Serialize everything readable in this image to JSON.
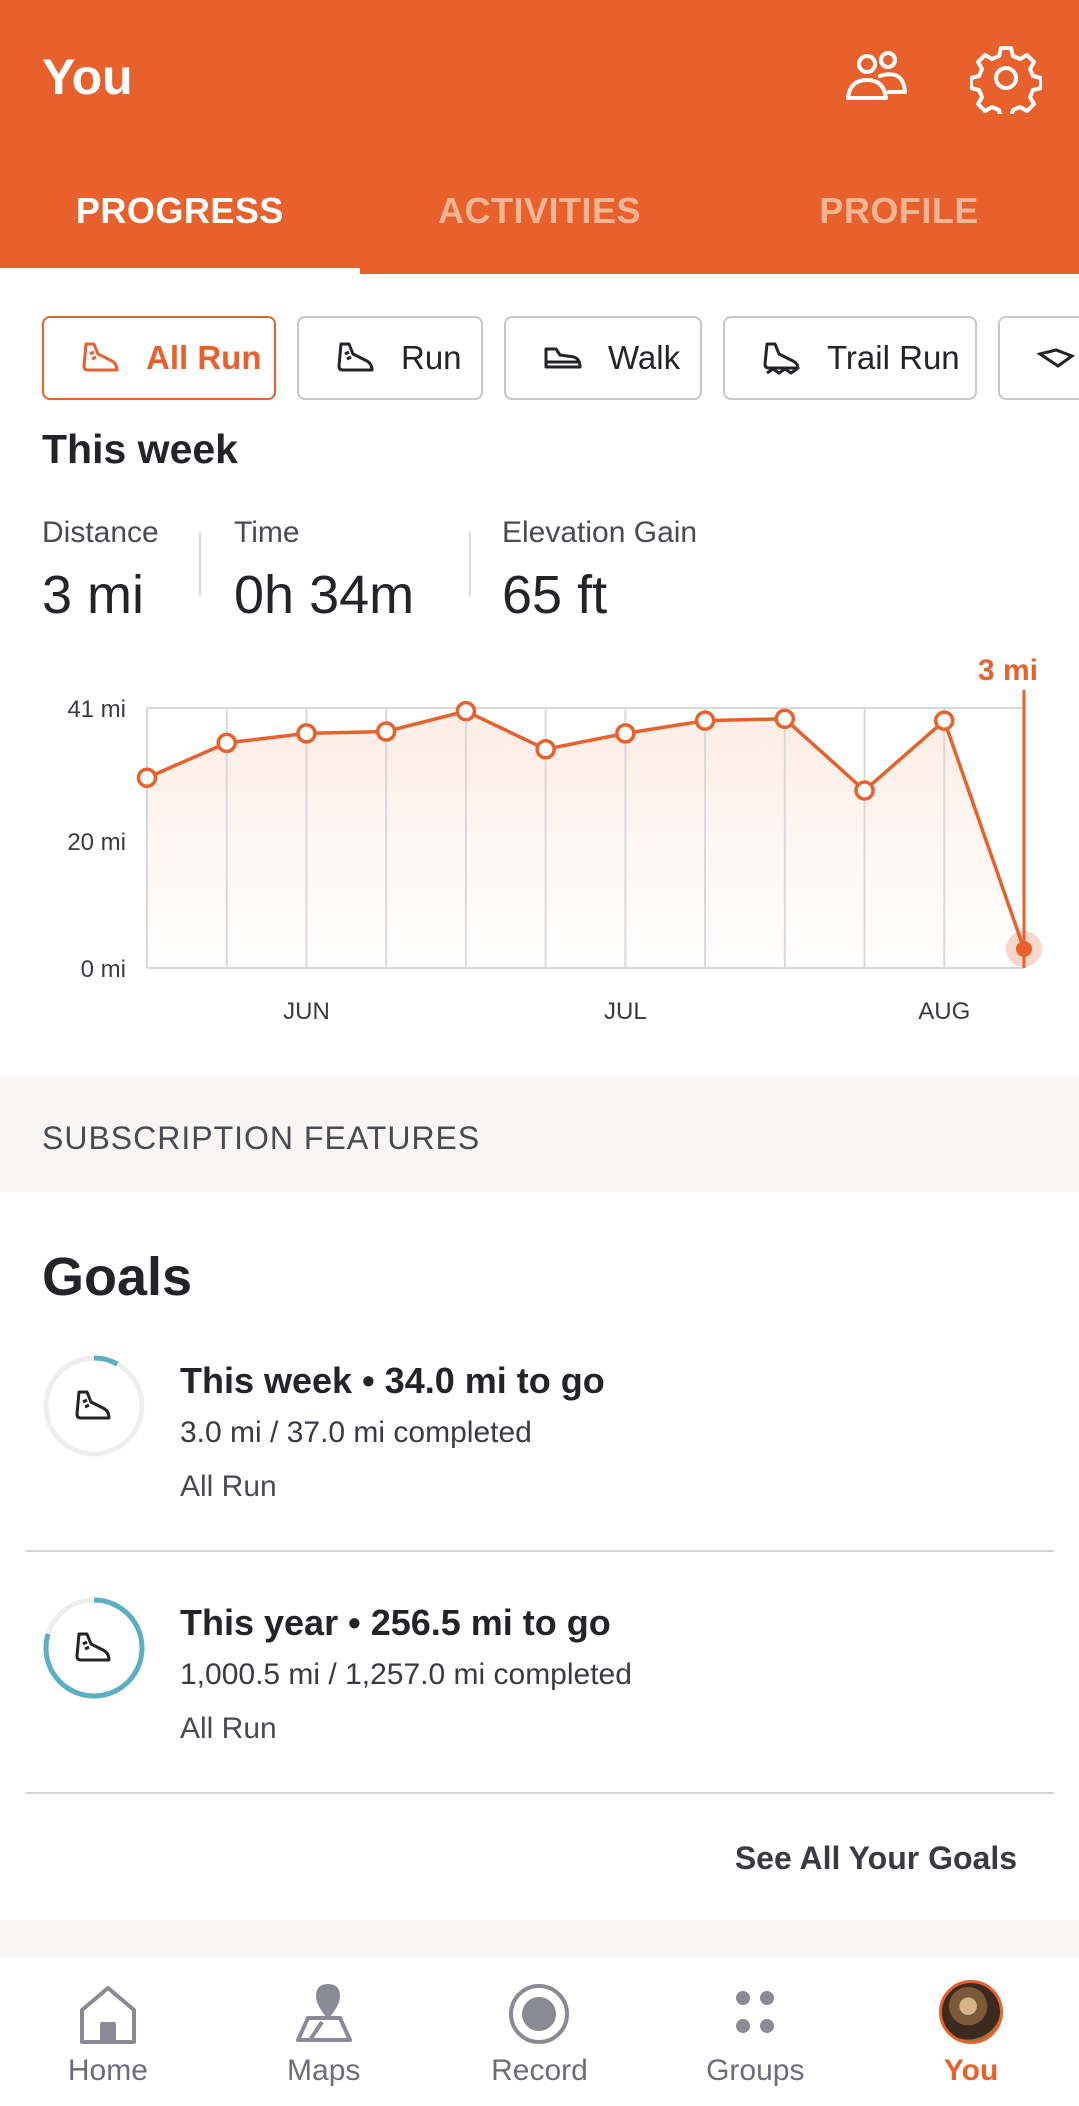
{
  "header": {
    "title": "You",
    "tabs": [
      "PROGRESS",
      "ACTIVITIES",
      "PROFILE"
    ],
    "active_tab": "PROGRESS"
  },
  "sport_chips": [
    "All Run",
    "Run",
    "Walk",
    "Trail Run"
  ],
  "this_week": {
    "title": "This week",
    "stats": [
      {
        "label": "Distance",
        "value": "3 mi"
      },
      {
        "label": "Time",
        "value": "0h 34m"
      },
      {
        "label": "Elevation Gain",
        "value": "65 ft"
      }
    ]
  },
  "chart_data": {
    "type": "line",
    "highlight_label": "3 mi",
    "y_tick_labels": [
      "41 mi",
      "20 mi",
      "0 mi"
    ],
    "y_ticks": [
      41,
      20,
      0
    ],
    "ylim": [
      0,
      41
    ],
    "x_tick_labels": [
      "JUN",
      "JUL",
      "AUG"
    ],
    "x_tick_positions": [
      2,
      6,
      10
    ],
    "series": [
      {
        "values": [
          30,
          35.5,
          37,
          37.3,
          40.5,
          34.5,
          37,
          39,
          39.3,
          28,
          39,
          3
        ]
      }
    ],
    "colors": {
      "line": "#E8612C",
      "fill": "#FDEDE4",
      "grid": "#D9D9DC"
    }
  },
  "subscription": {
    "label": "SUBSCRIPTION FEATURES"
  },
  "goals": {
    "title": "Goals",
    "items": [
      {
        "headline": "This week • 34.0 mi to go",
        "progress_text": "3.0 mi / 37.0 mi completed",
        "sport": "All Run",
        "fraction": 0.081
      },
      {
        "headline": "This year • 256.5 mi to go",
        "progress_text": "1,000.5 mi / 1,257.0 mi completed",
        "sport": "All Run",
        "fraction": 0.796
      }
    ],
    "see_all": "See All Your Goals"
  },
  "nav": {
    "items": [
      "Home",
      "Maps",
      "Record",
      "Groups",
      "You"
    ],
    "active": "You"
  },
  "colors": {
    "accent": "#E8612C",
    "goal_ring": "#5AAFC0"
  }
}
